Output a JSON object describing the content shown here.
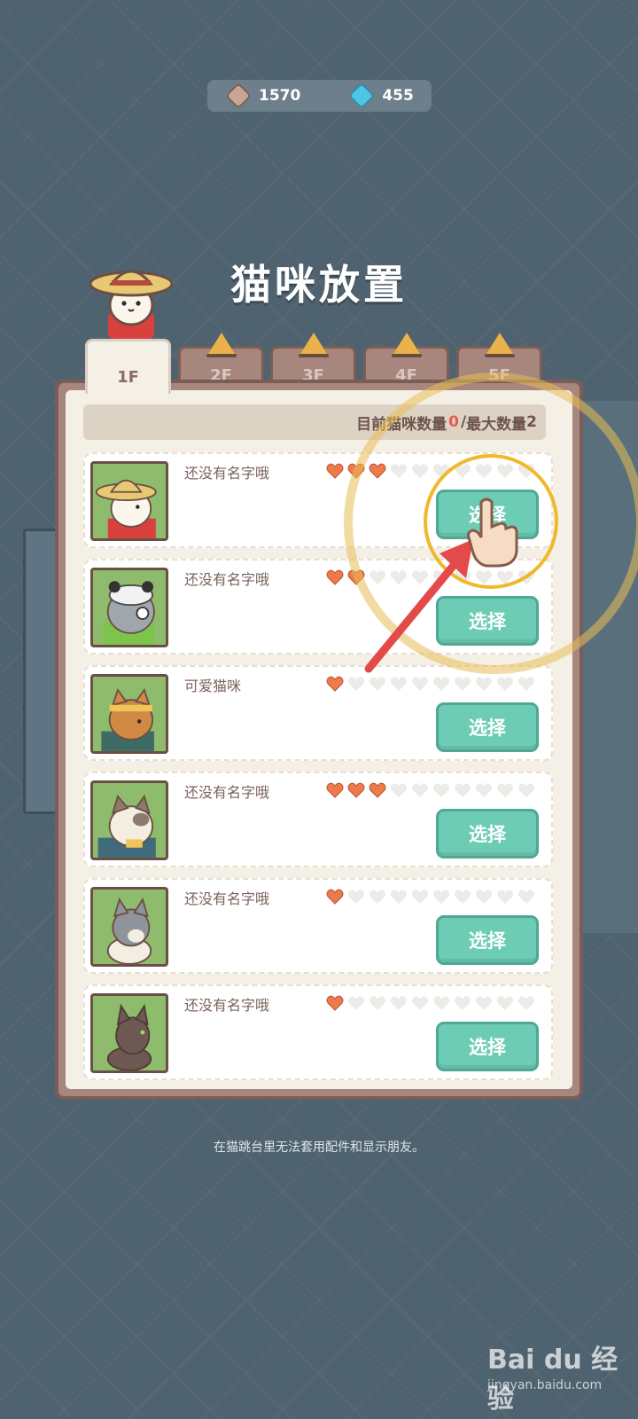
{
  "currency": {
    "coins": {
      "icon": "coin-plus-icon",
      "value": "1570"
    },
    "gems": {
      "icon": "gem-plus-icon",
      "value": "455"
    }
  },
  "title": "猫咪放置",
  "tabs": [
    {
      "label": "1F",
      "active": true,
      "locked": false
    },
    {
      "label": "2F",
      "active": false,
      "locked": true
    },
    {
      "label": "3F",
      "active": false,
      "locked": true
    },
    {
      "label": "4F",
      "active": false,
      "locked": true
    },
    {
      "label": "5F",
      "active": false,
      "locked": true
    }
  ],
  "count": {
    "current_label": "目前猫咪数量",
    "current": "0",
    "separator": "/",
    "max_label": "最大数量",
    "max": "2"
  },
  "cats": [
    {
      "name": "还没有名字哦",
      "hearts_filled": 3,
      "hearts_total": 10,
      "button": "选择",
      "avatar": "straw-hat-cat-avatar"
    },
    {
      "name": "还没有名字哦",
      "hearts_filled": 2,
      "hearts_total": 10,
      "button": "选择",
      "avatar": "panda-hat-cat-avatar"
    },
    {
      "name": "可爱猫咪",
      "hearts_filled": 1,
      "hearts_total": 10,
      "button": "选择",
      "avatar": "orange-headband-cat-avatar"
    },
    {
      "name": "还没有名字哦",
      "hearts_filled": 3,
      "hearts_total": 10,
      "button": "选择",
      "avatar": "calico-scarf-cat-avatar"
    },
    {
      "name": "还没有名字哦",
      "hearts_filled": 1,
      "hearts_total": 10,
      "button": "选择",
      "avatar": "gray-tabby-cat-avatar"
    },
    {
      "name": "还没有名字哦",
      "hearts_filled": 1,
      "hearts_total": 10,
      "button": "选择",
      "avatar": "brown-cat-avatar"
    }
  ],
  "footer_note": "在猫跳台里无法套用配件和显示朋友。",
  "watermark": {
    "brand": "Bai du 经验",
    "url": "jingyan.baidu.com"
  },
  "colors": {
    "background": "#4f626f",
    "panel_border": "#7c5d55",
    "panel_fill": "#f5f0e6",
    "button": "#6dcdb4",
    "heart_filled": "#ee7a4a",
    "heart_empty": "#ecebe8",
    "highlight_ring": "#f0b82b",
    "arrow": "#e44a4a"
  }
}
